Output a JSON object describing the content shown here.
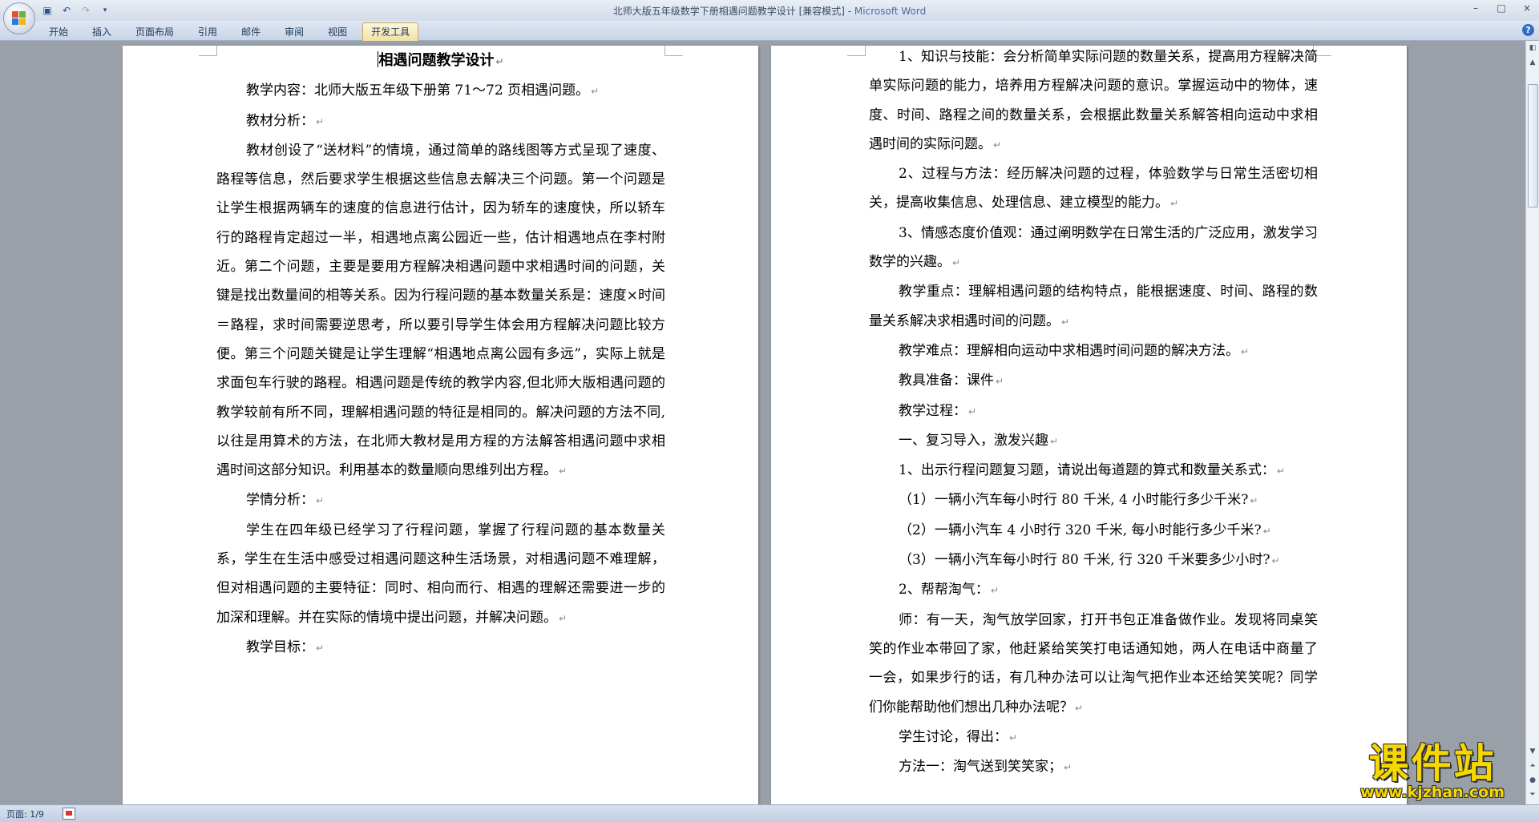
{
  "window": {
    "title": "北师大版五年级数学下册相遇问题教学设计 [兼容模式] - ",
    "app_name": "Microsoft Word",
    "controls": [
      "–",
      "□",
      "×"
    ]
  },
  "qat": [
    "save-icon",
    "undo-icon",
    "redo-icon",
    "customize-icon"
  ],
  "ribbon": {
    "tabs": [
      {
        "label": "开始"
      },
      {
        "label": "插入"
      },
      {
        "label": "页面布局"
      },
      {
        "label": "引用"
      },
      {
        "label": "邮件"
      },
      {
        "label": "审阅"
      },
      {
        "label": "视图"
      },
      {
        "label": "开发工具"
      }
    ],
    "active_tab": "开发工具"
  },
  "doc": {
    "left": {
      "title": "相遇问题教学设计",
      "paragraphs": [
        "教学内容：北师大版五年级下册第 71～72 页相遇问题。",
        "教材分析：",
        "教材创设了“送材料”的情境，通过简单的路线图等方式呈现了速度、路程等信息，然后要求学生根据这些信息去解决三个问题。第一个问题是让学生根据两辆车的速度的信息进行估计，因为轿车的速度快，所以轿车行的路程肯定超过一半，相遇地点离公园近一些，估计相遇地点在李村附近。第二个问题，主要是要用方程解决相遇问题中求相遇时间的问题，关键是找出数量间的相等关系。因为行程问题的基本数量关系是：速度×时间＝路程，求时间需要逆思考，所以要引导学生体会用方程解决问题比较方便。第三个问题关键是让学生理解“相遇地点离公园有多远”，实际上就是求面包车行驶的路程。相遇问题是传统的教学内容,但北师大版相遇问题的教学较前有所不同，理解相遇问题的特征是相同的。解决问题的方法不同,以往是用算术的方法，在北师大教材是用方程的方法解答相遇问题中求相遇时间这部分知识。利用基本的数量顺向思维列出方程。",
        "学情分析：",
        "学生在四年级已经学习了行程问题，掌握了行程问题的基本数量关系，学生在生活中感受过相遇问题这种生活场景，对相遇问题不难理解，但对相遇问题的主要特征：同时、相向而行、相遇的理解还需要进一步的加深和理解。并在实际的情境中提出问题，并解决问题。",
        "教学目标："
      ]
    },
    "right": {
      "paragraphs": [
        "1、知识与技能：会分析简单实际问题的数量关系，提高用方程解决简单实际问题的能力，培养用方程解决问题的意识。掌握运动中的物体，速度、时间、路程之间的数量关系，会根据此数量关系解答相向运动中求相遇时间的实际问题。",
        "2、过程与方法：经历解决问题的过程，体验数学与日常生活密切相关，提高收集信息、处理信息、建立模型的能力。",
        "3、情感态度价值观：通过阐明数学在日常生活的广泛应用，激发学习数学的兴趣。",
        "教学重点：理解相遇问题的结构特点，能根据速度、时间、路程的数量关系解决求相遇时间的问题。",
        "教学难点：理解相向运动中求相遇时间问题的解决方法。",
        "教具准备：课件",
        "教学过程：",
        "一、复习导入，激发兴趣",
        "1、出示行程问题复习题，请说出每道题的算式和数量关系式：",
        "（1）一辆小汽车每小时行 80 千米, 4 小时能行多少千米?",
        "（2）一辆小汽车 4 小时行 320 千米, 每小时能行多少千米?",
        "（3）一辆小汽车每小时行 80 千米, 行 320 千米要多少小时?",
        "2、帮帮淘气：",
        "师：有一天，淘气放学回家，打开书包正准备做作业。发现将同桌笑笑的作业本带回了家，他赶紧给笑笑打电话通知她，两人在电话中商量了一会，如果步行的话，有几种办法可以让淘气把作业本还给笑笑呢？同学们你能帮助他们想出几种办法呢？",
        "学生讨论，得出：",
        "方法一：淘气送到笑笑家；"
      ]
    },
    "paragraph_mark": "↵"
  },
  "status": {
    "page": "页面: 1/9"
  },
  "watermark": {
    "main": "课件站",
    "url": "www.kjzhan.com"
  }
}
